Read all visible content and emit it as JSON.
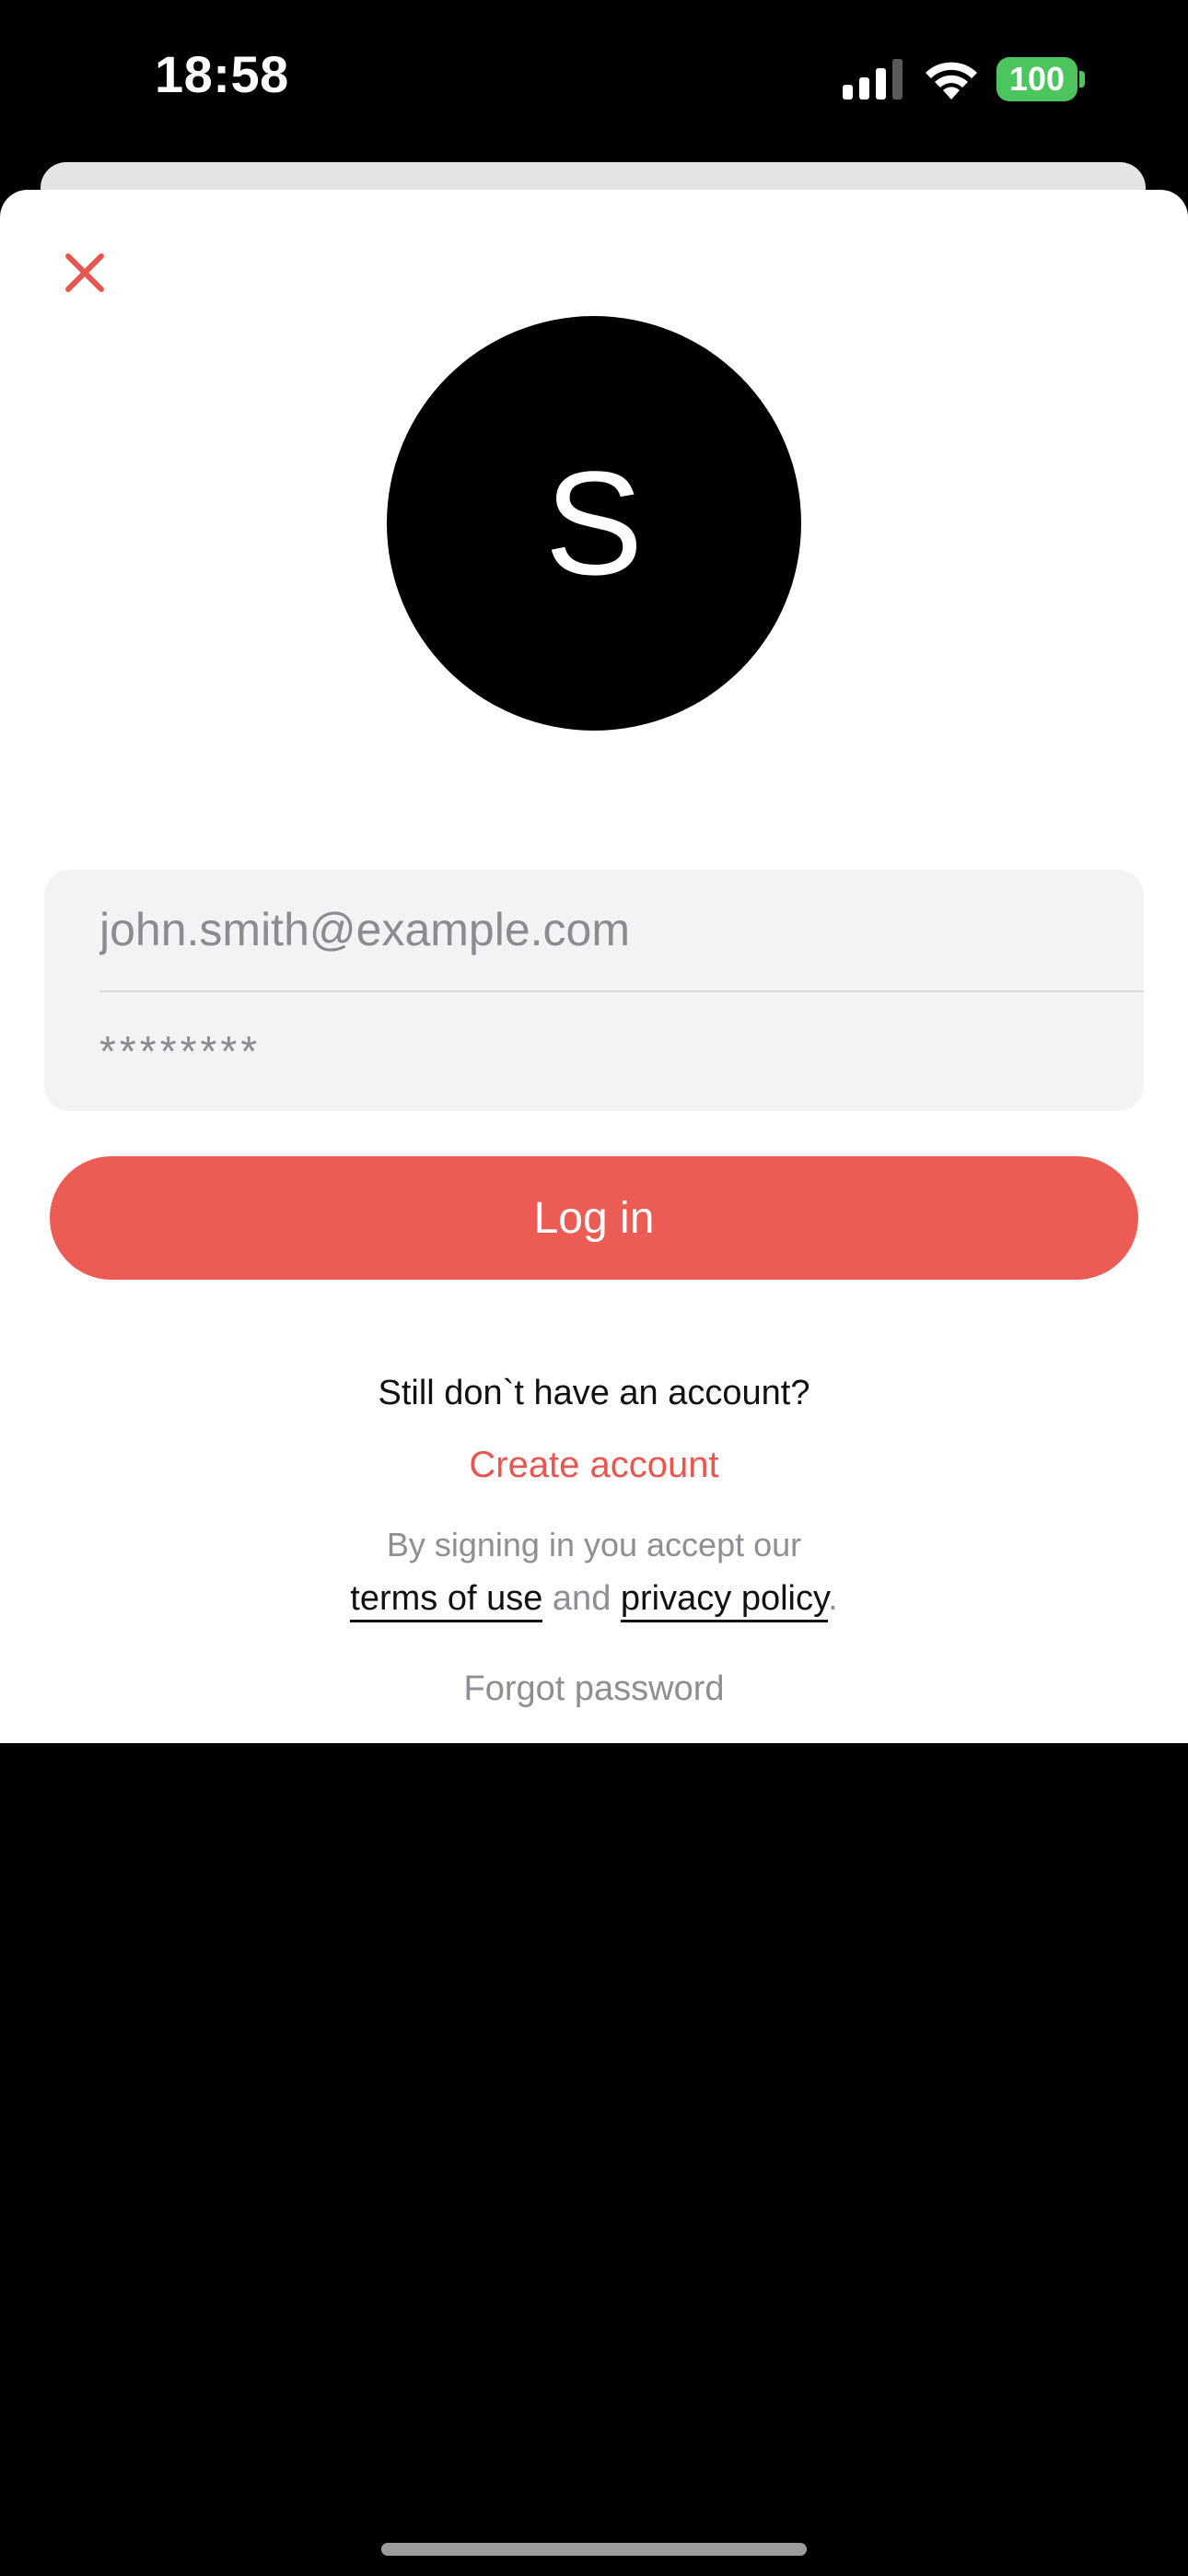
{
  "status_bar": {
    "time": "18:58",
    "battery": "100",
    "icons": [
      "signal-icon",
      "wifi-icon",
      "battery-icon"
    ]
  },
  "login": {
    "close_icon": "close-icon",
    "avatar_letter": "S",
    "email_placeholder": "john.smith@example.com",
    "password_placeholder": "********",
    "login_button": "Log in",
    "no_account_text": "Still don`t have an account?",
    "create_account": "Create account",
    "accept_text": "By signing in you accept our",
    "terms": "terms of use",
    "and": "and",
    "privacy": "privacy policy",
    "period": ".",
    "forgot_password": "Forgot password"
  },
  "colors": {
    "accent": "#ec5c55",
    "battery": "#4cc55e",
    "field_bg": "#f2f3f5"
  }
}
